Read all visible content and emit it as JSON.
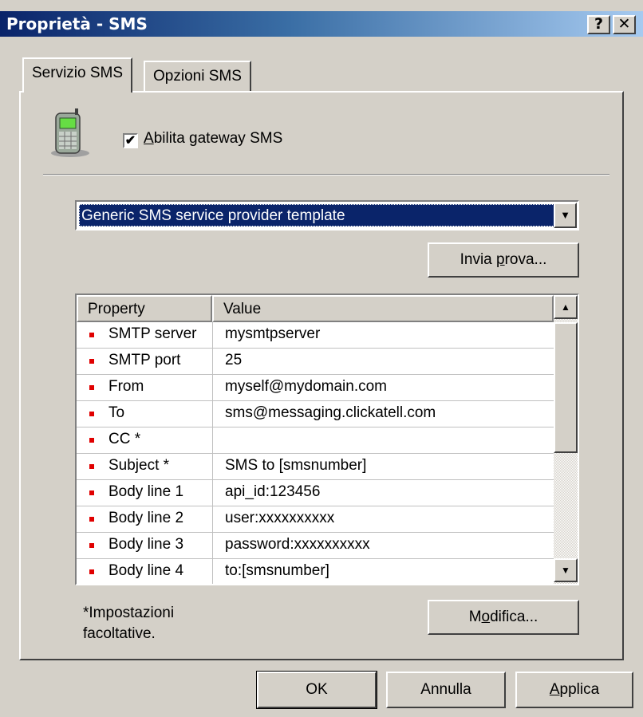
{
  "window": {
    "title": "Proprietà - SMS",
    "help_button": "?",
    "close_button": "✕"
  },
  "tabs": [
    {
      "label": "Servizio SMS",
      "active": true
    },
    {
      "label": "Opzioni SMS",
      "active": false
    }
  ],
  "gateway": {
    "icon": "mobile-phone-icon",
    "checkbox_checked": true,
    "checkbox_mark": "✔",
    "label_access": "A",
    "label_rest": "bilita gateway SMS"
  },
  "provider": {
    "selected": "Generic SMS service provider template",
    "dropdown_arrow": "▼"
  },
  "send_test": {
    "pre": "Invia ",
    "access": "p",
    "post": "rova..."
  },
  "grid": {
    "headers": {
      "property": "Property",
      "value": "Value"
    },
    "rows": [
      {
        "property": "SMTP server",
        "value": "mysmtpserver"
      },
      {
        "property": "SMTP port",
        "value": "25"
      },
      {
        "property": "From",
        "value": "myself@mydomain.com"
      },
      {
        "property": "To",
        "value": "sms@messaging.clickatell.com"
      },
      {
        "property": "CC *",
        "value": ""
      },
      {
        "property": "Subject *",
        "value": "SMS to [smsnumber]"
      },
      {
        "property": "Body line 1",
        "value": "api_id:123456"
      },
      {
        "property": "Body line 2",
        "value": "user:xxxxxxxxxx"
      },
      {
        "property": "Body line 3",
        "value": "password:xxxxxxxxxx"
      },
      {
        "property": "Body line 4",
        "value": "to:[smsnumber]"
      }
    ],
    "bullet_color": "#e00000",
    "scroll_up": "▲",
    "scroll_down": "▼"
  },
  "note": {
    "line1": "*Impostazioni",
    "line2": "facoltative."
  },
  "edit_button": {
    "pre": "M",
    "access": "o",
    "post": "difica..."
  },
  "footer": {
    "ok": "OK",
    "cancel": "Annulla",
    "apply_access": "A",
    "apply_rest": "pplica"
  },
  "colors": {
    "title_bar_start": "#0a246a",
    "title_bar_end": "#a6caf0",
    "dialog_face": "#d4d0c8",
    "selection": "#0a246a"
  }
}
